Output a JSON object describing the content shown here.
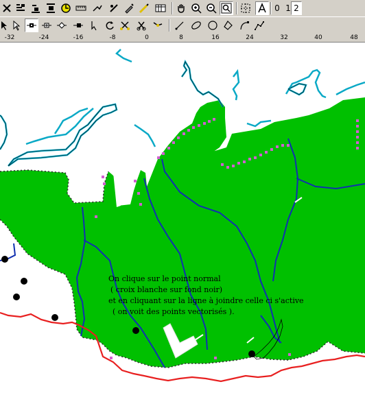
{
  "toolbar": {
    "nums": [
      "0",
      "1",
      "2"
    ],
    "active_num": "2"
  },
  "ruler": {
    "labels": [
      "-32",
      "-24",
      "-16",
      "-8",
      "0",
      "8",
      "16",
      "24",
      "32",
      "40",
      "48"
    ]
  },
  "annotation": {
    "line1": "On clique sur le point normal",
    "line2": "( croix blanche sur fond noir)",
    "line3": "et en cliquant sur la ligne à joindre celle ci s'active",
    "line4": "( on voit des points vectorisés )."
  },
  "colors": {
    "land": "#00c000",
    "coast": "#0aa9c6",
    "river": "#1030b0",
    "boundary": "#e82020",
    "vertex": "#d060d0"
  },
  "icons": {
    "row1": [
      "close-icon",
      "align-left-icon",
      "align-bottom-icon",
      "align-top-icon",
      "circle-icon",
      "ruler-icon",
      "tool-icon",
      "tool2-icon",
      "pen-icon",
      "table-icon",
      "pan-hand-icon",
      "zoom-in-icon",
      "zoom-out-icon",
      "zoom-extent-icon",
      "select-region-icon",
      "text-a-icon"
    ],
    "row2": [
      "pointer-icon",
      "select-icon",
      "node-icon",
      "add-node-icon",
      "diamond-node-icon",
      "end-node-icon",
      "line-icon",
      "rotate-icon",
      "cut-x-icon",
      "scissors-icon",
      "join-icon",
      "draw-line-icon",
      "ellipse-icon",
      "circle-draw-icon",
      "polygon-icon",
      "curve-icon",
      "polyline-icon"
    ]
  }
}
